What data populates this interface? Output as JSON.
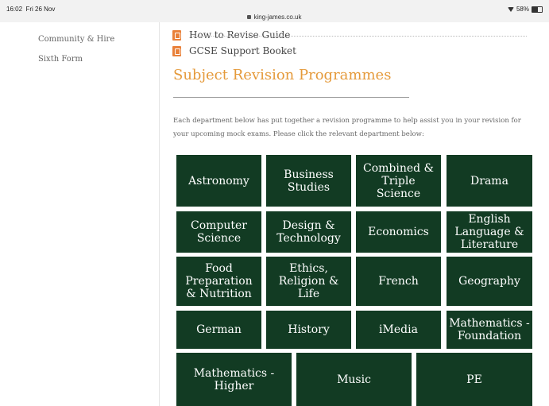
{
  "status": {
    "time": "16:02",
    "date": "Fri 26 Nov",
    "url": "king-james.co.uk",
    "battery": "58%",
    "battery_level": 0.58
  },
  "sidebar": {
    "items": [
      {
        "label": "Community & Hire"
      },
      {
        "label": "Sixth Form"
      }
    ]
  },
  "docs": [
    {
      "label": "How to Revise Guide"
    },
    {
      "label": "GCSE Support Booket"
    }
  ],
  "section": {
    "title": "Subject Revision Programmes",
    "intro": "Each department below has put together a revision programme to help assist you in your revision for your upcoming mock exams. Please click the relevant department below:"
  },
  "subjects": [
    {
      "label": "Astronomy"
    },
    {
      "label": "Business Studies"
    },
    {
      "label": "Combined & Triple Science"
    },
    {
      "label": "Drama"
    },
    {
      "label": "Computer Science"
    },
    {
      "label": "Design & Technology"
    },
    {
      "label": "Economics"
    },
    {
      "label": "English Language & Literature"
    },
    {
      "label": "Food Preparation & Nutrition"
    },
    {
      "label": "Ethics, Religion & Life"
    },
    {
      "label": "French"
    },
    {
      "label": "Geography"
    },
    {
      "label": "German"
    },
    {
      "label": "History"
    },
    {
      "label": "iMedia"
    },
    {
      "label": "Mathematics - Foundation"
    },
    {
      "label": "Mathematics - Higher"
    },
    {
      "label": "Music"
    },
    {
      "label": "PE"
    }
  ]
}
